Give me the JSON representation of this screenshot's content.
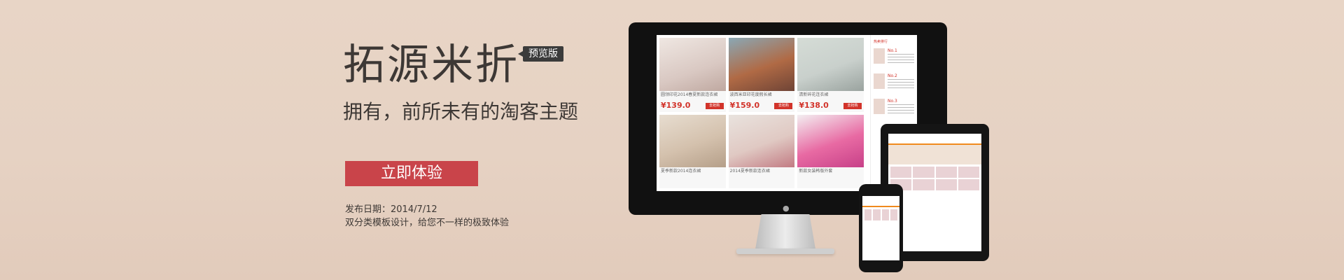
{
  "hero": {
    "title": "拓源米折",
    "badge": "预览版",
    "subtitle": "拥有，前所未有的淘客主题",
    "cta_label": "立即体验",
    "release_date": "发布日期：2014/7/12",
    "description": "双分类模板设计，给您不一样的极致体验"
  },
  "colors": {
    "accent": "#c9444a",
    "background": "#e8d5c6",
    "text": "#3d3835"
  },
  "imac": {
    "apple_logo": "",
    "products": [
      {
        "price": "¥139.0",
        "buy_label": "去抢购",
        "title": "圆领印花2014春夏新款连衣裙"
      },
      {
        "price": "¥159.0",
        "buy_label": "去抢购",
        "title": "波西米亚印花度假长裙"
      },
      {
        "price": "¥138.0",
        "buy_label": "去抢购",
        "title": "清新碎花连衣裙"
      },
      {
        "price": "",
        "buy_label": "",
        "title": "夏季新款2014连衣裙"
      },
      {
        "price": "",
        "buy_label": "",
        "title": "2014夏季新款连衣裙"
      },
      {
        "price": "",
        "buy_label": "",
        "title": "新款女装韩版外套"
      }
    ],
    "side_list_title": "热卖排行",
    "side_items": [
      {
        "no": "No.1"
      },
      {
        "no": "No.2"
      },
      {
        "no": "No.3"
      }
    ]
  }
}
